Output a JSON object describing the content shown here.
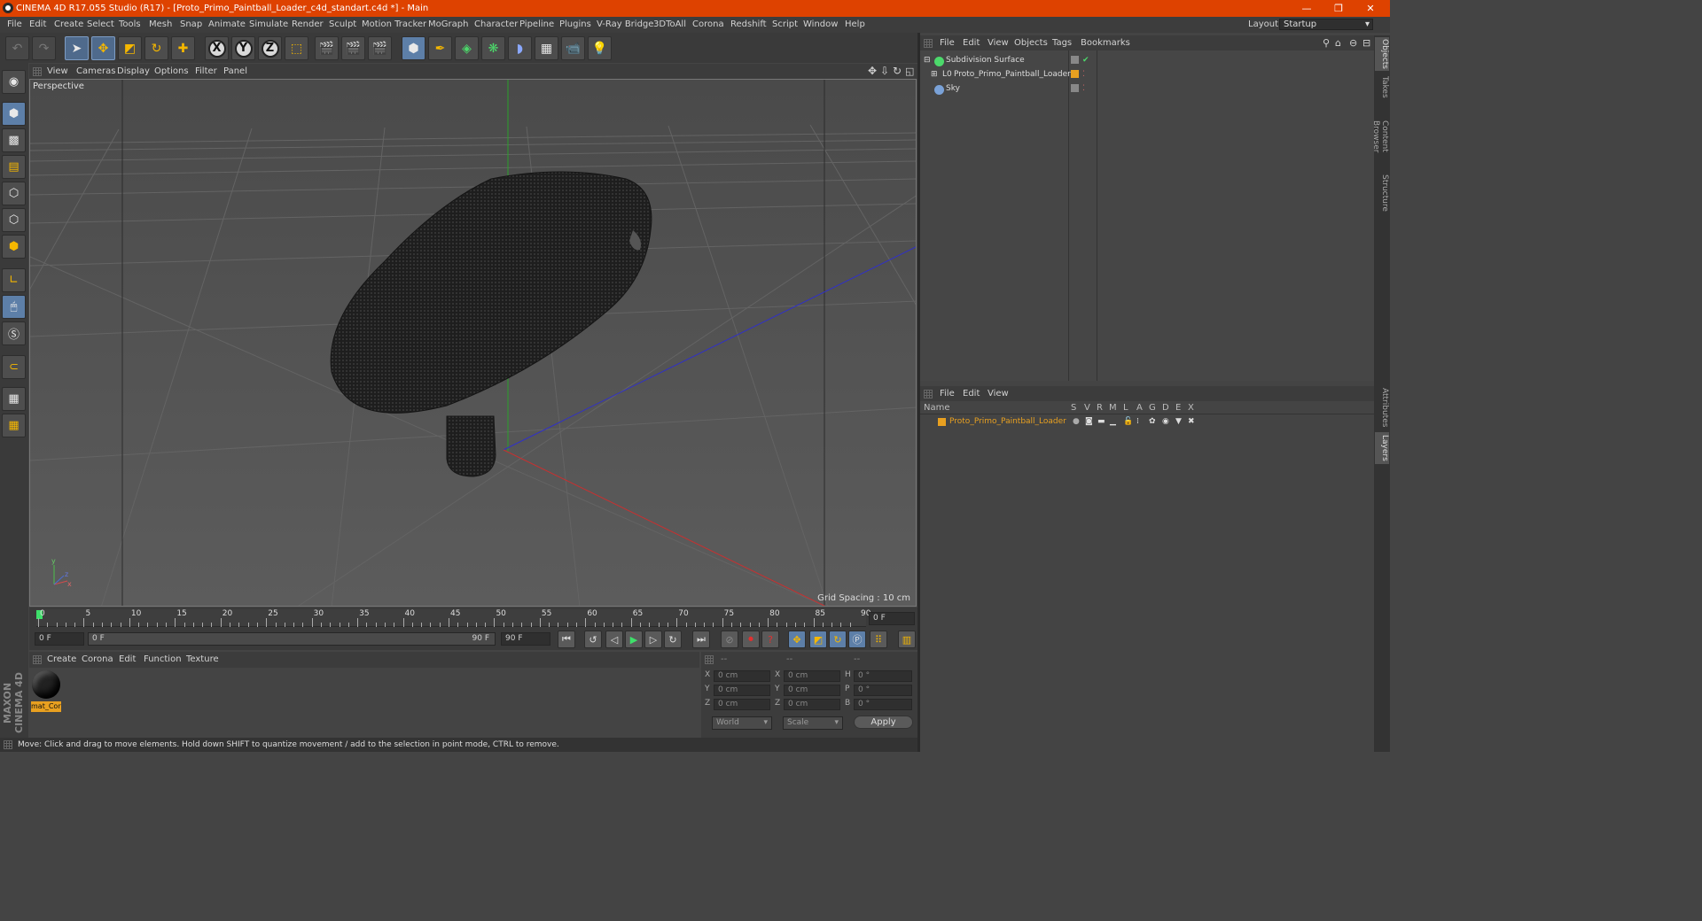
{
  "window": {
    "title": "CINEMA 4D R17.055 Studio (R17) - [Proto_Primo_Paintball_Loader_c4d_standart.c4d *] - Main",
    "minimize": "—",
    "restore": "❐",
    "close": "✕"
  },
  "menu": [
    "File",
    "Edit",
    "Create",
    "Select",
    "Tools",
    "Mesh",
    "Snap",
    "Animate",
    "Simulate",
    "Render",
    "Sculpt",
    "Motion Tracker",
    "MoGraph",
    "Character",
    "Pipeline",
    "Plugins",
    "V-Ray Bridge",
    "3DToAll",
    "Corona",
    "Redshift",
    "Script",
    "Window",
    "Help"
  ],
  "layout": {
    "label": "Layout:",
    "value": "Startup"
  },
  "toolbar": {
    "x": "X",
    "y": "Y",
    "z": "Z"
  },
  "viewport": {
    "menu": [
      "View",
      "Cameras",
      "Display",
      "Options",
      "Filter",
      "Panel"
    ],
    "label": "Perspective",
    "grid_spacing": "Grid Spacing : 10 cm"
  },
  "timeline": {
    "ticks": [
      "0",
      "5",
      "10",
      "15",
      "20",
      "25",
      "30",
      "35",
      "40",
      "45",
      "50",
      "55",
      "60",
      "65",
      "70",
      "75",
      "80",
      "85",
      "90"
    ],
    "current": "0 F",
    "start": "0 F",
    "range_start": "0 F",
    "range_end": "90 F",
    "end": "90 F"
  },
  "material": {
    "menu": [
      "Create",
      "Corona",
      "Edit",
      "Function",
      "Texture"
    ],
    "items": [
      {
        "name": "mat_Cor"
      }
    ]
  },
  "coords": {
    "header": [
      "--",
      "--",
      "--"
    ],
    "rows": [
      {
        "a": "X",
        "v1": "0 cm",
        "b": "X",
        "v2": "0 cm",
        "c": "H",
        "v3": "0 °"
      },
      {
        "a": "Y",
        "v1": "0 cm",
        "b": "Y",
        "v2": "0 cm",
        "c": "P",
        "v3": "0 °"
      },
      {
        "a": "Z",
        "v1": "0 cm",
        "b": "Z",
        "v2": "0 cm",
        "c": "B",
        "v3": "0 °"
      }
    ],
    "world": "World",
    "scale": "Scale",
    "apply": "Apply"
  },
  "status": "Move: Click and drag to move elements. Hold down SHIFT to quantize movement / add to the selection in point mode, CTRL to remove.",
  "objects": {
    "menu": [
      "File",
      "Edit",
      "View",
      "Objects",
      "Tags",
      "Bookmarks"
    ],
    "items": [
      "Subdivision Surface",
      "Proto_Primo_Paintball_Loader",
      "Sky"
    ]
  },
  "layers": {
    "menu": [
      "File",
      "Edit",
      "View"
    ],
    "columns": [
      "Name",
      "S",
      "V",
      "R",
      "M",
      "L",
      "A",
      "G",
      "D",
      "E",
      "X"
    ],
    "items": [
      "Proto_Primo_Paintball_Loader"
    ]
  },
  "right_tabs": [
    "Objects",
    "Takes",
    "Content Browser",
    "Structure",
    "Attributes",
    "Layers"
  ],
  "brand": "MAXON CINEMA 4D",
  "colors": {
    "title": "#de4200",
    "layer": "#e8a020",
    "accent": "#5d7fa8"
  }
}
